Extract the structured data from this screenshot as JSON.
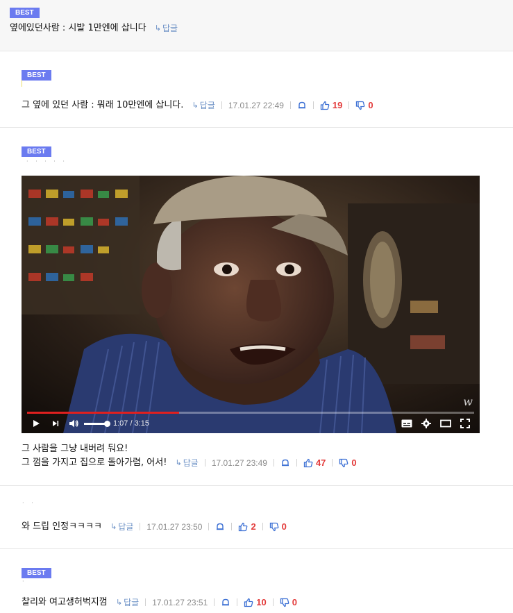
{
  "badge_label": "BEST",
  "reply_label": "답글",
  "comments": [
    {
      "text": "옆에있던사람 : 시발 1만엔에 삽니다"
    },
    {
      "text": "그 옆에 있던 사람 : 뭐래 10만엔에 삽니다.",
      "date": "17.01.27 22:49",
      "likes": "19",
      "dislikes": "0"
    },
    {
      "lines": [
        "그 사람을 그냥 내버려 둬요!",
        "그 껌을 가지고 집으로 돌아가렴, 어서!"
      ],
      "date": "17.01.27 23:49",
      "likes": "47",
      "dislikes": "0",
      "video": {
        "time": "1:07 / 3:15",
        "progress": 0.34,
        "volume": 1.0,
        "watermark": "w"
      }
    },
    {
      "text": "와 드립 인정ㅋㅋㅋㅋ",
      "date": "17.01.27 23:50",
      "likes": "2",
      "dislikes": "0"
    },
    {
      "text": "찰리와 여고생허벅지껌",
      "date": "17.01.27 23:51",
      "likes": "10",
      "dislikes": "0"
    }
  ],
  "icons": {
    "reply": "reply-arrow-icon",
    "bell": "notify-bell-icon",
    "like": "thumbs-up-icon",
    "dislike": "thumbs-down-icon",
    "play": "play-icon",
    "next": "next-icon",
    "volume": "volume-icon",
    "captions": "captions-icon",
    "settings": "gear-icon",
    "theater": "theater-mode-icon",
    "fullscreen": "fullscreen-icon"
  },
  "colors": {
    "badge": "#6b7bf0",
    "reply": "#6a8fc5",
    "count": "#e33b3b",
    "like_icon": "#3b6fd4",
    "progress": "#e0201f"
  }
}
